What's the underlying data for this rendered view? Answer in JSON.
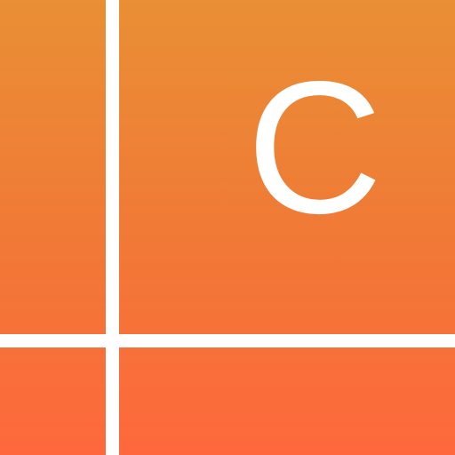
{
  "icon": {
    "letter": "C",
    "colors": {
      "gradient_top": "#e98f35",
      "gradient_bottom": "#fe683c",
      "lines": "#ffffff",
      "letter": "#ffffff"
    }
  }
}
